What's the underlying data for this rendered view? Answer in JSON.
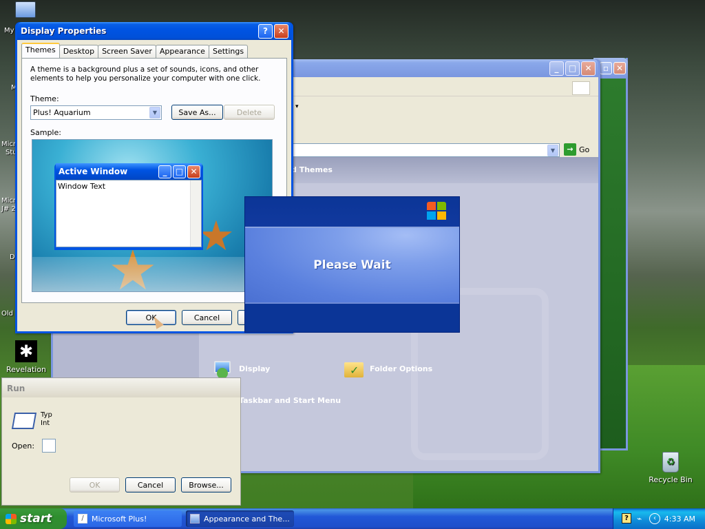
{
  "desktop": {
    "icons": [
      {
        "label": "Revelation"
      },
      {
        "label": "Recycle Bin"
      }
    ],
    "clipped_labels": [
      "My",
      "M",
      "Micro",
      "Stu",
      "Micro",
      "J# 2",
      "D",
      "Old"
    ]
  },
  "background_window": {
    "address_go": "Go",
    "task_header": "d Themes",
    "task_partial": "sk",
    "items": [
      {
        "label": "Display",
        "icon": "display-icon"
      },
      {
        "label": "Folder Options",
        "icon": "folder-options-icon"
      },
      {
        "label": "Taskbar and Start Menu",
        "icon": "taskbar-icon"
      }
    ]
  },
  "display_properties": {
    "title": "Display Properties",
    "help_btn": "?",
    "close_btn": "✕",
    "tabs": [
      "Themes",
      "Desktop",
      "Screen Saver",
      "Appearance",
      "Settings"
    ],
    "description": "A theme is a background plus a set of sounds, icons, and other elements to help you personalize your computer with one click.",
    "theme_label": "Theme:",
    "theme_value": "Plus! Aquarium",
    "save_as": "Save As...",
    "delete": "Delete",
    "sample_label": "Sample:",
    "sample_window_title": "Active Window",
    "sample_window_text": "Window Text",
    "ok": "OK",
    "cancel": "Cancel"
  },
  "please_wait": {
    "message": "Please Wait"
  },
  "run_dialog": {
    "title": "Run",
    "prompt_partial": "Typ\nInt",
    "open_label": "Open:",
    "ok": "OK",
    "cancel": "Cancel",
    "browse": "Browse..."
  },
  "taskbar": {
    "start": "start",
    "tasks": [
      {
        "label": "Microsoft Plus!",
        "active": false
      },
      {
        "label": "Appearance and The...",
        "active": true
      }
    ],
    "clock": "4:33 AM"
  },
  "colors": {
    "xp_blue": "#0054e3",
    "dialog_face": "#ece9d8",
    "cp_bg": "#c5c8dc",
    "please_wait_dark": "#0b3597",
    "start_green": "#308b30"
  }
}
